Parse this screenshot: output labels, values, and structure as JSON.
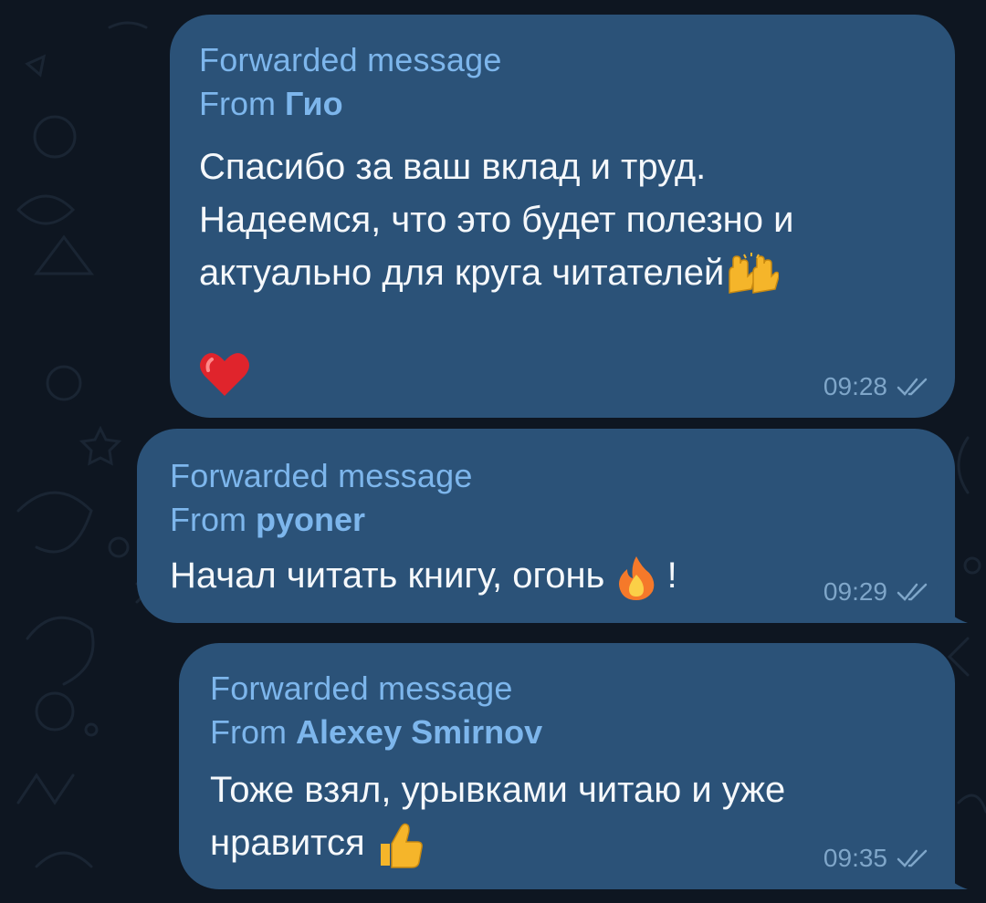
{
  "messages": [
    {
      "forwarded_label": "Forwarded message",
      "from_prefix": "From",
      "sender": "Гио",
      "text_lines": [
        "Спасибо за ваш вклад и труд.",
        "Надеемся, что это будет полезно и",
        "актуально для круга читателей"
      ],
      "trailing_emoji": "raising-hands-icon",
      "reaction": "heart-icon",
      "time": "09:28",
      "status": "read-double-check-icon"
    },
    {
      "forwarded_label": "Forwarded message",
      "from_prefix": "From",
      "sender": "pyoner",
      "text_before": "Начал читать книгу, огонь",
      "inline_emoji": "fire-icon",
      "text_after": "!",
      "time": "09:29",
      "status": "read-double-check-icon"
    },
    {
      "forwarded_label": "Forwarded message",
      "from_prefix": "From",
      "sender": "Alexey Smirnov",
      "text_lines": [
        "Тоже взял, урывками читаю и уже",
        "нравится"
      ],
      "trailing_emoji": "thumbs-up-icon",
      "time": "09:35",
      "status": "read-double-check-icon"
    }
  ],
  "colors": {
    "background": "#0e1621",
    "bubble": "#2b5278",
    "accent": "#7db6ec",
    "time": "#7fa6c9",
    "text": "#f5f8fb"
  }
}
